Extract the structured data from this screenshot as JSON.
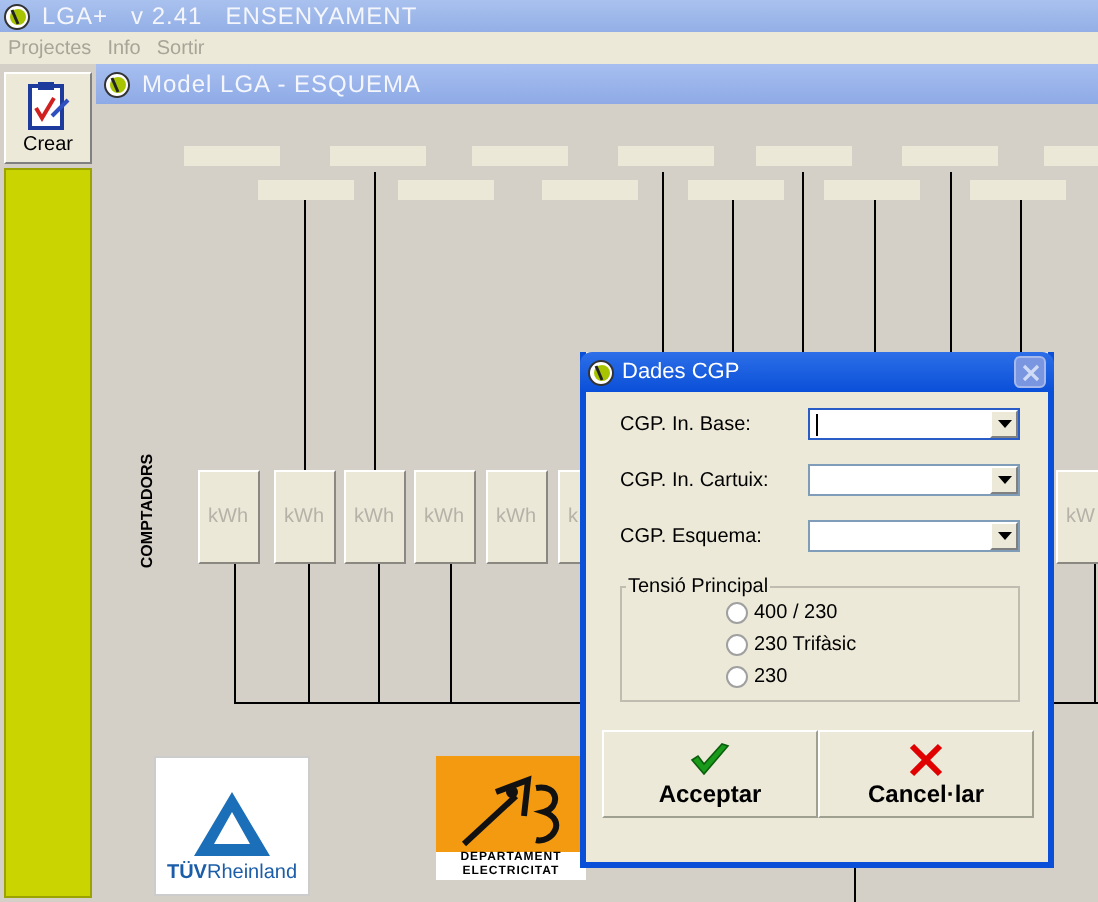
{
  "app": {
    "title": "LGA+   v 2.41   ENSENYAMENT",
    "menu": [
      {
        "label": "Projectes",
        "disabled": true
      },
      {
        "label": "Info",
        "disabled": true
      },
      {
        "label": "Sortir",
        "disabled": true
      }
    ],
    "toolbar": [
      {
        "label": "Crear"
      }
    ]
  },
  "child_window": {
    "title": "Model LGA - ESQUEMA"
  },
  "schematic": {
    "section_label": "COMPTADORS",
    "meters": [
      "kWh",
      "kWh",
      "kWh",
      "kWh",
      "kWh",
      "k",
      "kW"
    ]
  },
  "logos": [
    {
      "kind": "tuv",
      "text": "**TÜV**Rheinland"
    },
    {
      "kind": "department",
      "lines": [
        "DEPARTAMENT",
        "ELECTRICITAT"
      ]
    }
  ],
  "dialog": {
    "title": "Dades CGP",
    "fields": [
      {
        "label": "CGP. In. Base:",
        "focused": true
      },
      {
        "label": "CGP. In. Cartuix:",
        "focused": false
      },
      {
        "label": "CGP. Esquema:",
        "focused": false
      }
    ],
    "group": {
      "title": "Tensió Principal",
      "options": [
        {
          "label": "400 / 230",
          "selected": false
        },
        {
          "label": "230 Trifàsic",
          "selected": false
        },
        {
          "label": "230",
          "selected": false
        }
      ]
    },
    "buttons": [
      {
        "label": "Acceptar",
        "kind": "accept"
      },
      {
        "label": "Cancel·lar",
        "kind": "cancel"
      }
    ]
  }
}
